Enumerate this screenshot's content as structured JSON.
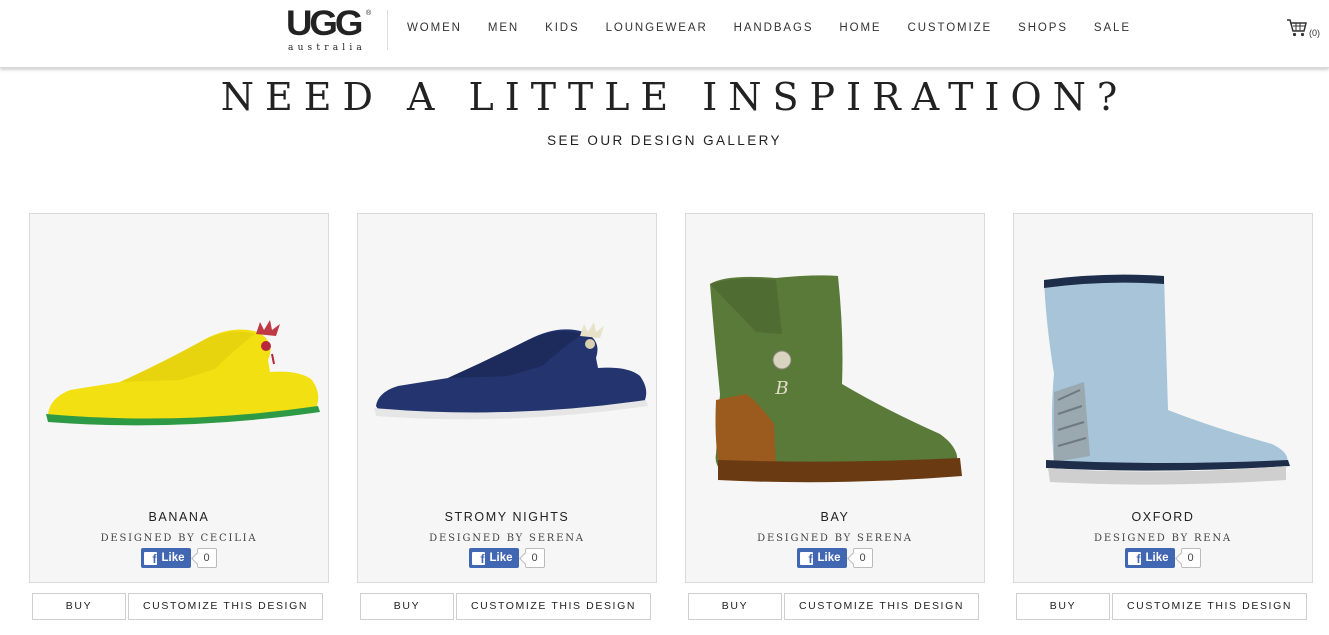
{
  "brand": {
    "logo_main": "UGG",
    "logo_sub": "australia",
    "logo_reg": "®"
  },
  "nav": [
    "WOMEN",
    "MEN",
    "KIDS",
    "LOUNGEWEAR",
    "HANDBAGS",
    "HOME",
    "CUSTOMIZE",
    "SHOPS",
    "SALE"
  ],
  "cart": {
    "icon": "cart-icon",
    "count": "(0)"
  },
  "hero": {
    "title": "NEED A LITTLE INSPIRATION?",
    "link": "SEE OUR DESIGN GALLERY"
  },
  "products": [
    {
      "name": "BANANA",
      "designer": "DESIGNED BY CECILIA",
      "likes": "0",
      "like_label": "Like",
      "buy": "BUY",
      "customize": "CUSTOMIZE THIS DESIGN",
      "colors": {
        "upper": "#f2e012",
        "sole": "#2e9a45"
      }
    },
    {
      "name": "STROMY NIGHTS",
      "designer": "DESIGNED BY SERENA",
      "likes": "0",
      "like_label": "Like",
      "buy": "BUY",
      "customize": "CUSTOMIZE THIS DESIGN",
      "colors": {
        "upper": "#23346e",
        "sole": "#e6e6e6"
      }
    },
    {
      "name": "BAY",
      "designer": "DESIGNED BY SERENA",
      "likes": "0",
      "like_label": "Like",
      "buy": "BUY",
      "customize": "CUSTOMIZE THIS DESIGN",
      "colors": {
        "upper": "#5a7a3a",
        "heel": "#9b5a1e",
        "sole": "#6a3a12"
      }
    },
    {
      "name": "OXFORD",
      "designer": "DESIGNED BY RENA",
      "likes": "0",
      "like_label": "Like",
      "buy": "BUY",
      "customize": "CUSTOMIZE THIS DESIGN",
      "colors": {
        "upper": "#a7c4d8",
        "trim": "#1e2e4a",
        "sole": "#cfcfcf"
      }
    }
  ]
}
